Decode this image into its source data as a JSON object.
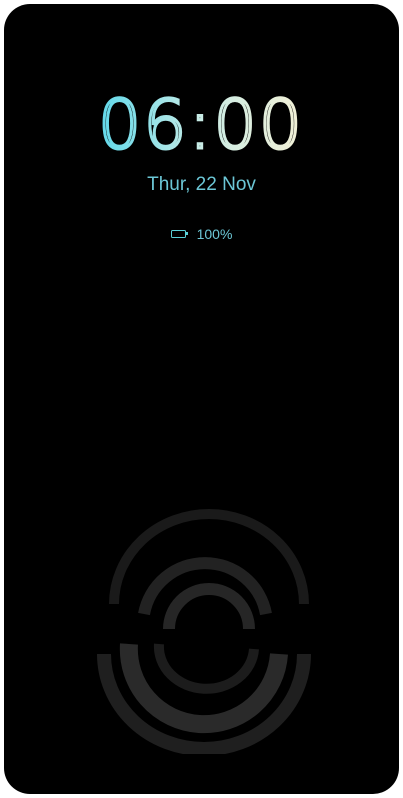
{
  "lockscreen": {
    "time": "06:00",
    "date": "Thur, 22 Nov",
    "battery_percent": "100%",
    "battery_level": 1.0,
    "accent_color": "#6cc7d6",
    "icons": {
      "battery": "battery-icon",
      "fingerprint": "fingerprint-icon"
    }
  }
}
